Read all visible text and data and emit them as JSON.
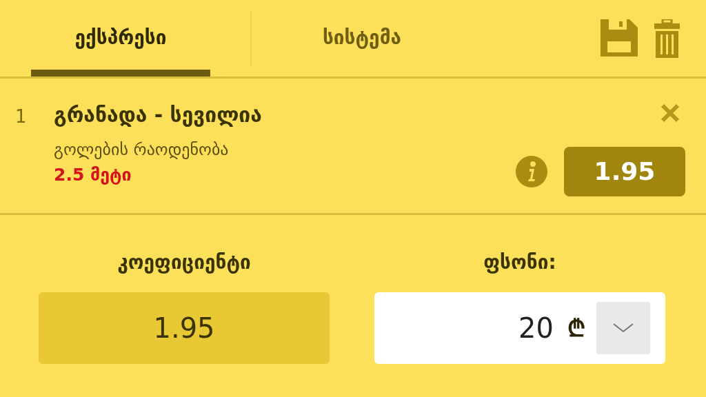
{
  "tabs": [
    {
      "label": "ექსპრესი",
      "selected": true
    },
    {
      "label": "სისტემა",
      "selected": false
    }
  ],
  "bets": [
    {
      "number": "1",
      "match": "გრანადა - სევილია",
      "market": "გოლების რაოდენობა",
      "pick": "2.5 მეტი",
      "odds": "1.95"
    }
  ],
  "summary": {
    "odds_label": "კოეფიციენტი",
    "odds_value": "1.95",
    "stake_label": "ფსონი:",
    "stake_value": "20",
    "currency": "₾"
  }
}
